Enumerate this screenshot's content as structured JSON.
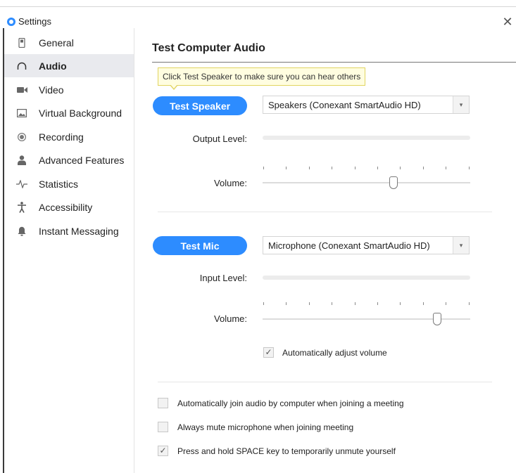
{
  "window": {
    "title": "Settings",
    "close_glyph": "✕",
    "logo_icon": "app-logo-icon"
  },
  "sidebar": {
    "items": [
      {
        "label": "General",
        "icon": "general-icon",
        "active": false
      },
      {
        "label": "Audio",
        "icon": "headphones-icon",
        "active": true
      },
      {
        "label": "Video",
        "icon": "video-camera-icon",
        "active": false
      },
      {
        "label": "Virtual Background",
        "icon": "background-image-icon",
        "active": false
      },
      {
        "label": "Recording",
        "icon": "record-icon",
        "active": false
      },
      {
        "label": "Advanced Features",
        "icon": "user-icon",
        "active": false
      },
      {
        "label": "Statistics",
        "icon": "pulse-icon",
        "active": false
      },
      {
        "label": "Accessibility",
        "icon": "accessibility-icon",
        "active": false
      },
      {
        "label": "Instant Messaging",
        "icon": "bell-icon",
        "active": false
      }
    ]
  },
  "main": {
    "title": "Test Computer Audio",
    "tooltip": "Click Test Speaker to make sure you can hear others",
    "speaker": {
      "button": "Test Speaker",
      "device": "Speakers (Conexant SmartAudio HD)",
      "output_label": "Output Level:",
      "volume_label": "Volume:",
      "volume_level": 0.63
    },
    "mic": {
      "button": "Test Mic",
      "device": "Microphone (Conexant SmartAudio HD)",
      "input_label": "Input Level:",
      "volume_label": "Volume:",
      "volume_level": 0.84,
      "auto_adjust_label": "Automatically adjust volume",
      "auto_adjust_checked": true
    },
    "options": [
      {
        "label": "Automatically join audio by computer when joining a meeting",
        "checked": false
      },
      {
        "label": "Always mute microphone when joining meeting",
        "checked": false
      },
      {
        "label": "Press and hold SPACE key to temporarily unmute yourself",
        "checked": true
      }
    ],
    "check_glyph": "✓",
    "dropdown_glyph": "▾"
  },
  "colors": {
    "accent": "#2d8cff",
    "active_nav": "#e9eaee",
    "tooltip_bg": "#fffde0"
  }
}
